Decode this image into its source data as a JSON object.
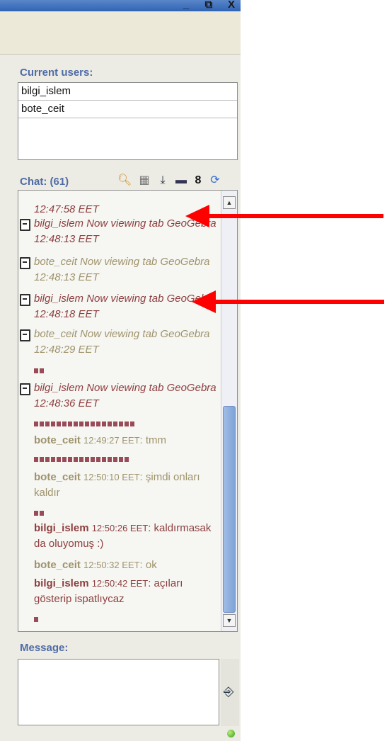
{
  "window": {
    "buttons": [
      "_",
      "⧉",
      "X"
    ]
  },
  "users_panel": {
    "label": "Current users:",
    "users": [
      "bilgi_islem",
      "bote_ceit"
    ]
  },
  "chat": {
    "label": "Chat: (61)",
    "toolbar_icons": [
      "search-icon",
      "image-icon",
      "download-icon",
      "minimize-icon",
      "text-icon",
      "refresh-icon"
    ],
    "system_messages": [
      {
        "text": "12:47:58 EET",
        "color": "red"
      },
      {
        "text": "bilgi_islem Now viewing tab GeoGebra 12:48:13 EET",
        "color": "red"
      },
      {
        "text": "bote_ceit Now viewing tab GeoGebra 12:48:13 EET",
        "color": "tan"
      },
      {
        "text": "bilgi_islem Now viewing tab GeoGebra 12:48:18 EET",
        "color": "red"
      },
      {
        "text": "bote_ceit Now viewing tab GeoGebra 12:48:29 EET",
        "color": "tan"
      },
      {
        "text": "bilgi_islem Now viewing tab GeoGebra 12:48:36 EET",
        "color": "red"
      }
    ],
    "messages": [
      {
        "nick": "bote_ceit",
        "ts": "12:49:27 EET",
        "text": ": tmm",
        "color": "tan"
      },
      {
        "nick": "bote_ceit",
        "ts": "12:50:10 EET",
        "text": ": şimdi onları kaldır",
        "color": "tan"
      },
      {
        "nick": "bilgi_islem",
        "ts": "12:50:26 EET",
        "text": ": kaldırmasak da oluyomuş :)",
        "color": "red"
      },
      {
        "nick": "bote_ceit",
        "ts": "12:50:32 EET",
        "text": ": ok",
        "color": "tan"
      },
      {
        "nick": "bilgi_islem",
        "ts": "12:50:42 EET",
        "text": ": açıları gösterip ispatlıycaz",
        "color": "red"
      }
    ]
  },
  "message_panel": {
    "label": "Message:",
    "value": ""
  },
  "colors": {
    "label_blue": "#4f6ca6",
    "nick_red": "#8d3f3f",
    "nick_tan": "#9f936c",
    "arrow_red": "#ff0000"
  }
}
